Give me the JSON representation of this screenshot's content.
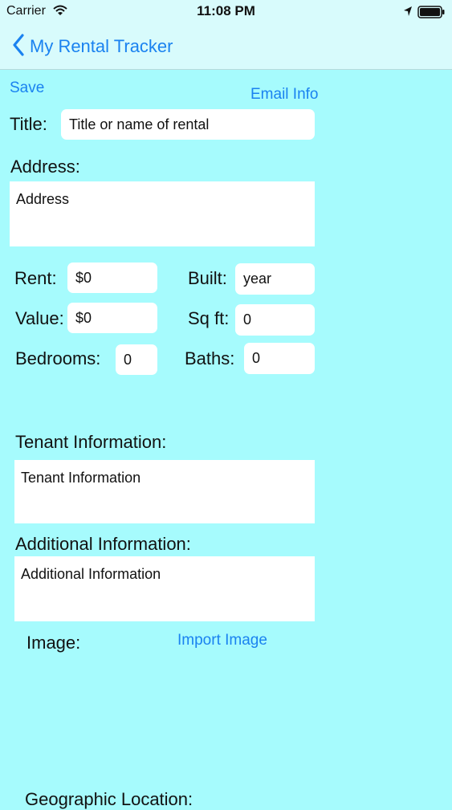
{
  "status_bar": {
    "carrier": "Carrier",
    "time": "11:08 PM",
    "icons": [
      "wifi-icon",
      "location-arrow-icon",
      "battery-icon"
    ]
  },
  "nav": {
    "back_label": "My Rental Tracker",
    "back_icon": "chevron-left-icon"
  },
  "actions": {
    "save": "Save",
    "email_info": "Email Info",
    "import_image": "Import Image"
  },
  "labels": {
    "title": "Title:",
    "address": "Address:",
    "rent": "Rent:",
    "built": "Built:",
    "value": "Value:",
    "sqft": "Sq ft:",
    "bedrooms": "Bedrooms:",
    "baths": "Baths:",
    "tenant_info": "Tenant Information:",
    "additional_info": "Additional Information:",
    "image": "Image:",
    "geographic_location": "Geographic Location:"
  },
  "fields": {
    "title": "Title or name of rental",
    "address": "Address",
    "rent": "$0",
    "built": "year",
    "value": "$0",
    "sqft": "0",
    "bedrooms": "0",
    "baths": "0",
    "tenant_info": "Tenant Information",
    "additional_info": "Additional Information"
  },
  "colors": {
    "background": "#a6fbfd",
    "bars": "#d8fbfc",
    "accent": "#1a82f0",
    "field": "#ffffff"
  }
}
